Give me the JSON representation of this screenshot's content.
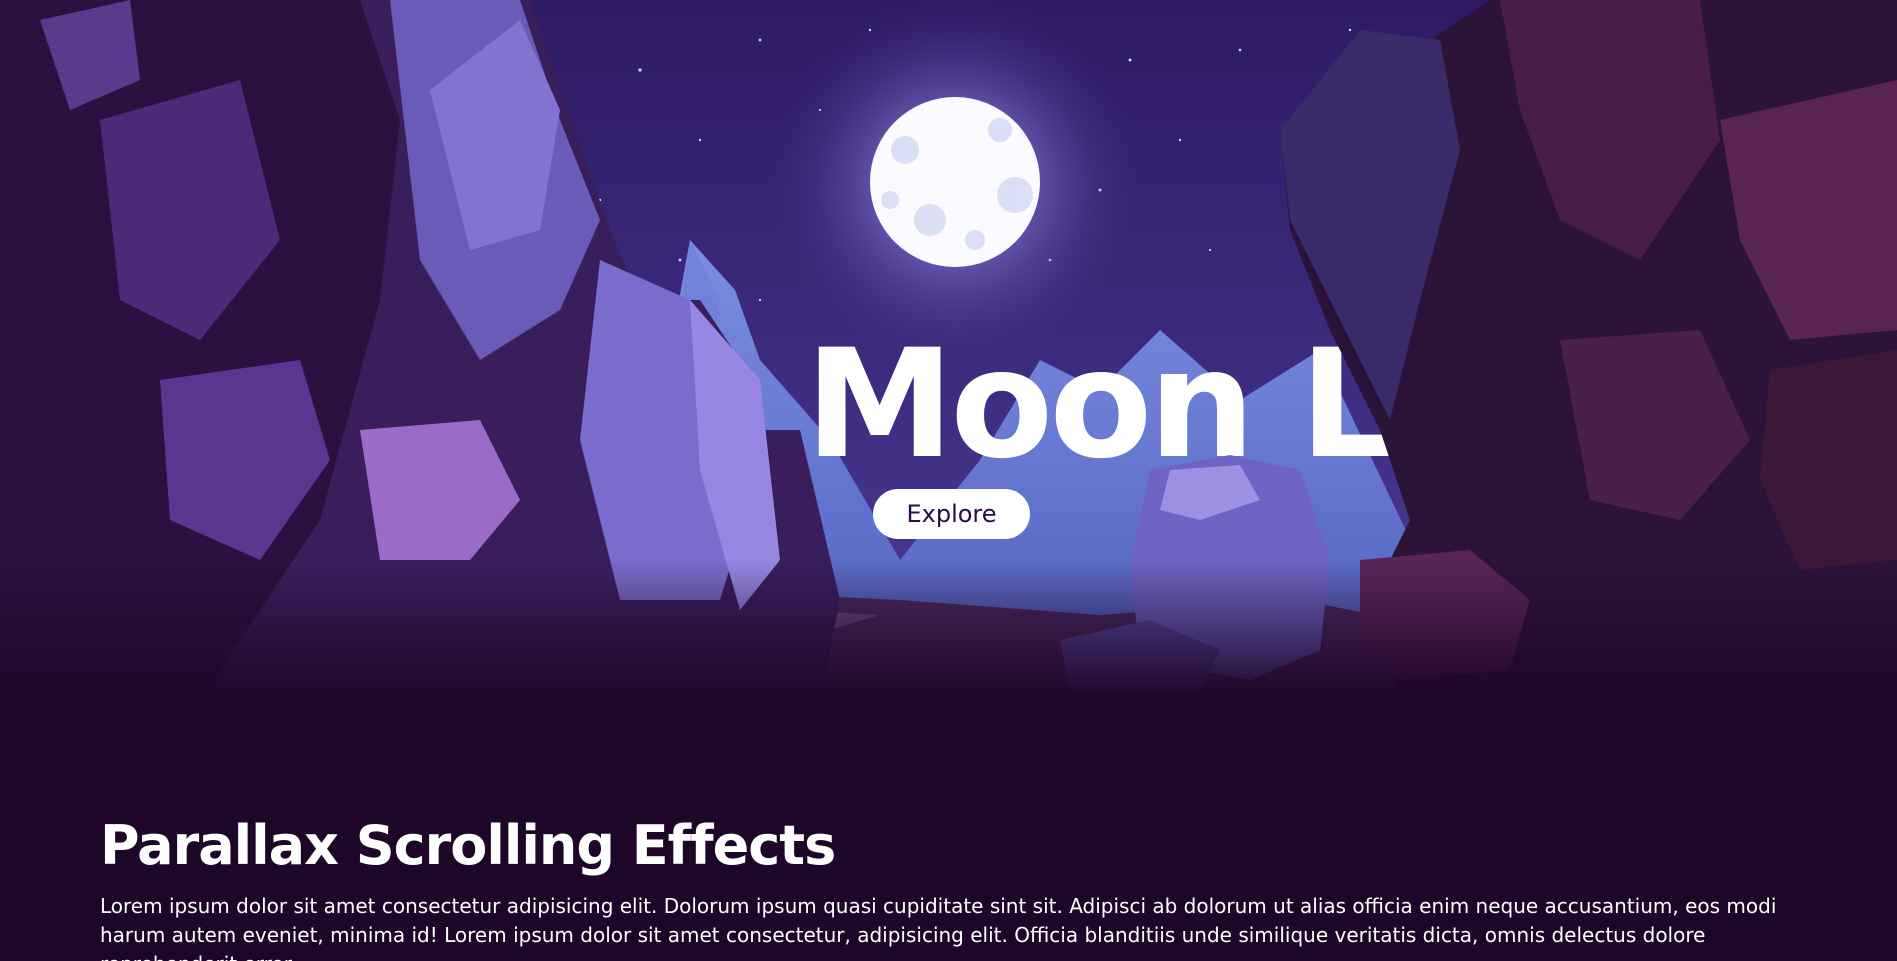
{
  "hero": {
    "title": "Moon Light",
    "explore_label": "Explore"
  },
  "section": {
    "heading": "Parallax Scrolling Effects",
    "body": "Lorem ipsum dolor sit amet consectetur adipisicing elit. Dolorum ipsum quasi cupiditate sint sit. Adipisci ab dolorum ut alias officia enim neque accusantium, eos modi harum autem eveniet, minima id! Lorem ipsum dolor sit amet consectetur, adipisicing elit. Officia blanditiis unde similique veritatis dicta, omnis delectus dolore reprehenderit error,"
  },
  "colors": {
    "background": "#1d0628",
    "sky": "#3b2777",
    "moon": "#ffffff",
    "button_text": "#2a0b45"
  }
}
